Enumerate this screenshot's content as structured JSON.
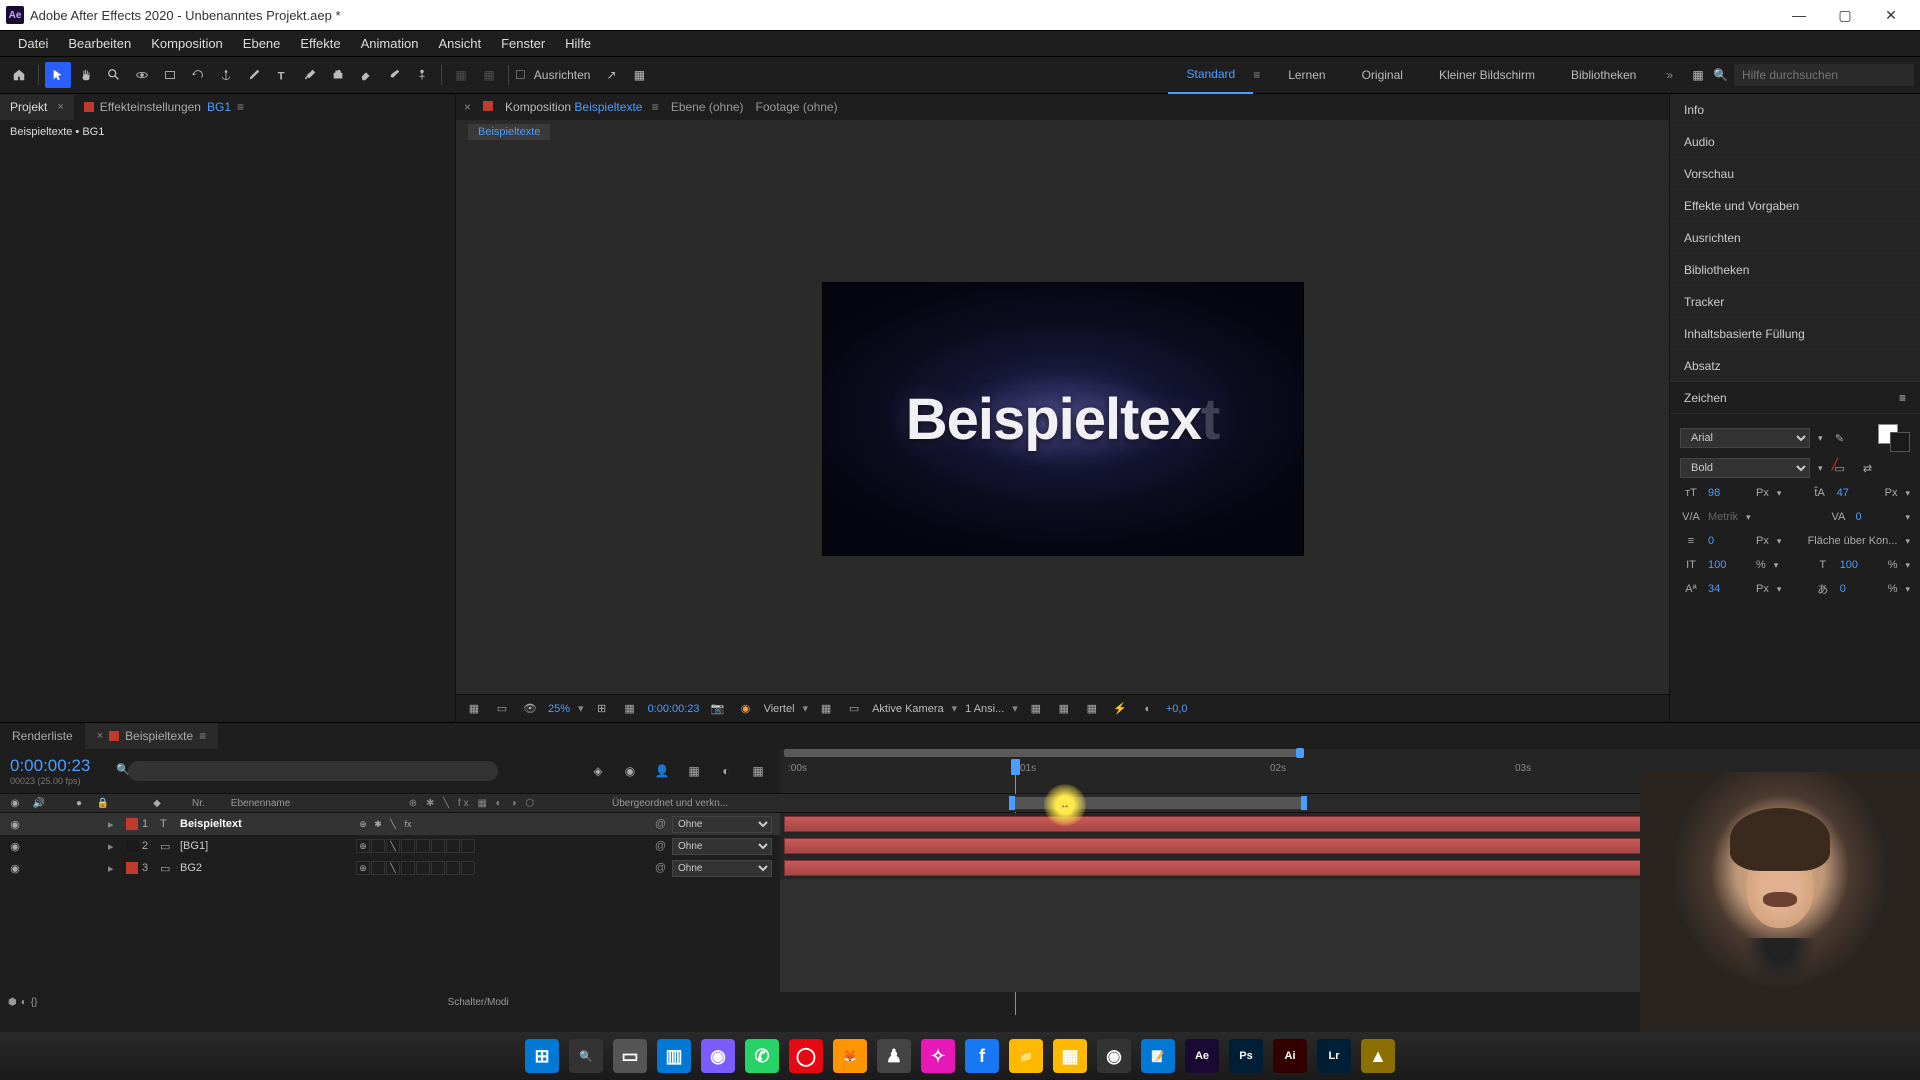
{
  "titlebar": {
    "app": "Adobe After Effects 2020 - Unbenanntes Projekt.aep *"
  },
  "menu": [
    "Datei",
    "Bearbeiten",
    "Komposition",
    "Ebene",
    "Effekte",
    "Animation",
    "Ansicht",
    "Fenster",
    "Hilfe"
  ],
  "toolbar": {
    "snap": "Ausrichten",
    "ws": [
      "Standard",
      "Lernen",
      "Original",
      "Kleiner Bildschirm",
      "Bibliotheken"
    ],
    "search_ph": "Hilfe durchsuchen",
    "icons": [
      "home",
      "select",
      "hand",
      "zoom",
      "orbit",
      "rect",
      "rotate",
      "anchor",
      "pen",
      "text",
      "brush",
      "stamp",
      "eraser",
      "roto",
      "puppet"
    ]
  },
  "left": {
    "tab_project": "Projekt",
    "tab_fx": "Effekteinstellungen",
    "tab_fx_layer": "BG1",
    "breadcrumb": "Beispieltexte • BG1"
  },
  "center": {
    "tab_comp": "Komposition",
    "comp_name": "Beispieltexte",
    "tab_layer": "Ebene  (ohne)",
    "tab_footage": "Footage  (ohne)",
    "crumb": "Beispieltexte",
    "text_content": "Beispieltext",
    "footer": {
      "zoom": "25%",
      "time": "0:00:00:23",
      "res": "Viertel",
      "cam": "Aktive Kamera",
      "views": "1 Ansi...",
      "exposure": "+0,0"
    }
  },
  "right": {
    "panels": [
      "Info",
      "Audio",
      "Vorschau",
      "Effekte und Vorgaben",
      "Ausrichten",
      "Bibliotheken",
      "Tracker",
      "Inhaltsbasierte Füllung",
      "Absatz"
    ],
    "char_title": "Zeichen",
    "char": {
      "font": "Arial",
      "weight": "Bold",
      "size": "98",
      "size_u": "Px",
      "lead": "47",
      "lead_u": "Px",
      "kern": "Metrik",
      "track": "0",
      "stroke": "0",
      "stroke_u": "Px",
      "fill_opt": "Fläche über Kon...",
      "hscale": "100",
      "hscale_u": "%",
      "vscale": "100",
      "vscale_u": "%",
      "bshift": "34",
      "bshift_u": "Px",
      "tsume": "0",
      "tsume_u": "%"
    }
  },
  "timeline": {
    "tab_render": "Renderliste",
    "tab_comp": "Beispieltexte",
    "curtime": "0:00:00:23",
    "curframe": "00023 (25.00 fps)",
    "cols": {
      "nr": "Nr.",
      "name": "Ebenenname",
      "parent": "Übergeordnet und verkn..."
    },
    "ticks": [
      ":00s",
      "01s",
      "02s",
      "03s"
    ],
    "parent_opt": "Ohne",
    "layers": [
      {
        "num": "1",
        "color": "#c0392b",
        "type": "T",
        "name": "Beispieltext",
        "sel": true,
        "start": 0,
        "full": true,
        "fx": true
      },
      {
        "num": "2",
        "color": "#1a1a1a",
        "type": "",
        "name": "[BG1]",
        "sel": false,
        "start": 0,
        "full": true,
        "fx": false
      },
      {
        "num": "3",
        "color": "#c0392b",
        "type": "",
        "name": "BG2",
        "sel": false,
        "start": 0,
        "full": true,
        "fx": false
      }
    ],
    "footer": "Schalter/Modi"
  },
  "taskbar": {
    "items": [
      {
        "c": "#0078d4",
        "t": "⊞"
      },
      {
        "c": "#333",
        "t": "🔍"
      },
      {
        "c": "#555",
        "t": "▭"
      },
      {
        "c": "#0078d4",
        "t": "▥"
      },
      {
        "c": "#7b5cff",
        "t": "◉"
      },
      {
        "c": "#25d366",
        "t": "✆"
      },
      {
        "c": "#e50914",
        "t": "◯"
      },
      {
        "c": "#ff9500",
        "t": "🦊"
      },
      {
        "c": "#444",
        "t": "♟"
      },
      {
        "c": "#e619b8",
        "t": "✧"
      },
      {
        "c": "#1877f2",
        "t": "f"
      },
      {
        "c": "#ffb900",
        "t": "📁"
      },
      {
        "c": "#ffb900",
        "t": "▦"
      },
      {
        "c": "#333",
        "t": "◉"
      },
      {
        "c": "#0078d4",
        "t": "📝"
      },
      {
        "c": "#1a0a33",
        "t": "Ae"
      },
      {
        "c": "#001e36",
        "t": "Ps"
      },
      {
        "c": "#330000",
        "t": "Ai"
      },
      {
        "c": "#001e36",
        "t": "Lr"
      },
      {
        "c": "#8b6f00",
        "t": "▲"
      }
    ]
  }
}
